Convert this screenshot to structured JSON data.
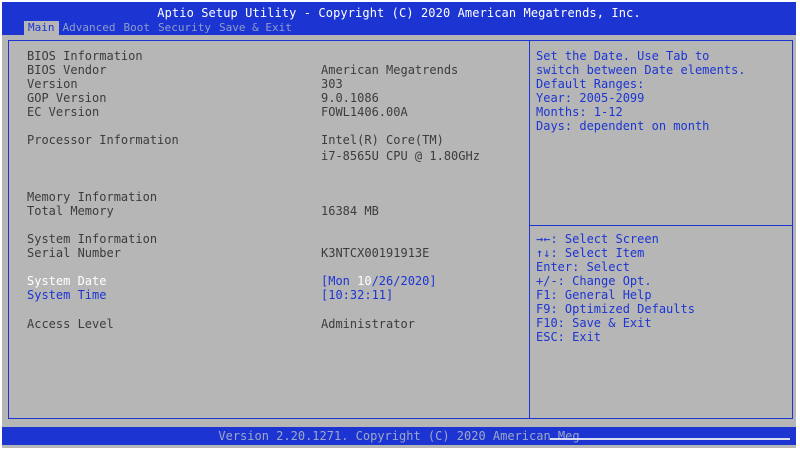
{
  "header": {
    "title": "Aptio Setup Utility - Copyright (C) 2020 American Megatrends, Inc.",
    "tabs": [
      "Main",
      "Advanced",
      "Boot",
      "Security",
      "Save & Exit"
    ],
    "active_tab": "Main"
  },
  "main": {
    "bios_info_heading": "BIOS Information",
    "bios_vendor_label": "BIOS Vendor",
    "bios_vendor_value": "American Megatrends",
    "version_label": "Version",
    "version_value": "303",
    "gop_version_label": "GOP Version",
    "gop_version_value": "9.0.1086",
    "ec_version_label": "EC Version",
    "ec_version_value": "FOWL1406.00A",
    "processor_label": "Processor Information",
    "processor_value_line1": "Intel(R) Core(TM)",
    "processor_value_line2": "i7-8565U CPU @ 1.80GHz",
    "memory_info_heading": "Memory Information",
    "total_memory_label": "Total Memory",
    "total_memory_value": "16384 MB",
    "system_info_heading": "System Information",
    "serial_label": "Serial Number",
    "serial_value": "K3NTCX00191913E",
    "system_date_label": "System Date",
    "system_date_prefix": "[Mon ",
    "system_date_month": "10",
    "system_date_suffix": "/26/2020]",
    "system_time_label": "System Time",
    "system_time_value": "[10:32:11]",
    "access_level_label": "Access Level",
    "access_level_value": "Administrator"
  },
  "help": {
    "description": [
      "Set the Date. Use Tab to",
      "switch between Date elements.",
      "Default Ranges:",
      "Year: 2005-2099",
      "Months: 1-12",
      "Days: dependent on month"
    ],
    "keys": [
      "→←: Select Screen",
      "↑↓: Select Item",
      "Enter: Select",
      "+/-: Change Opt.",
      "F1: General Help",
      "F9: Optimized Defaults",
      "F10: Save & Exit",
      "ESC: Exit"
    ]
  },
  "footer": {
    "version": "Version 2.20.1271. Copyright (C) 2020 American Meg"
  },
  "colors": {
    "bar_blue": "#1c35d2",
    "background_gray": "#b6b6b6",
    "text_dark": "#3c3c3c",
    "selected_white": "#ffffff"
  }
}
